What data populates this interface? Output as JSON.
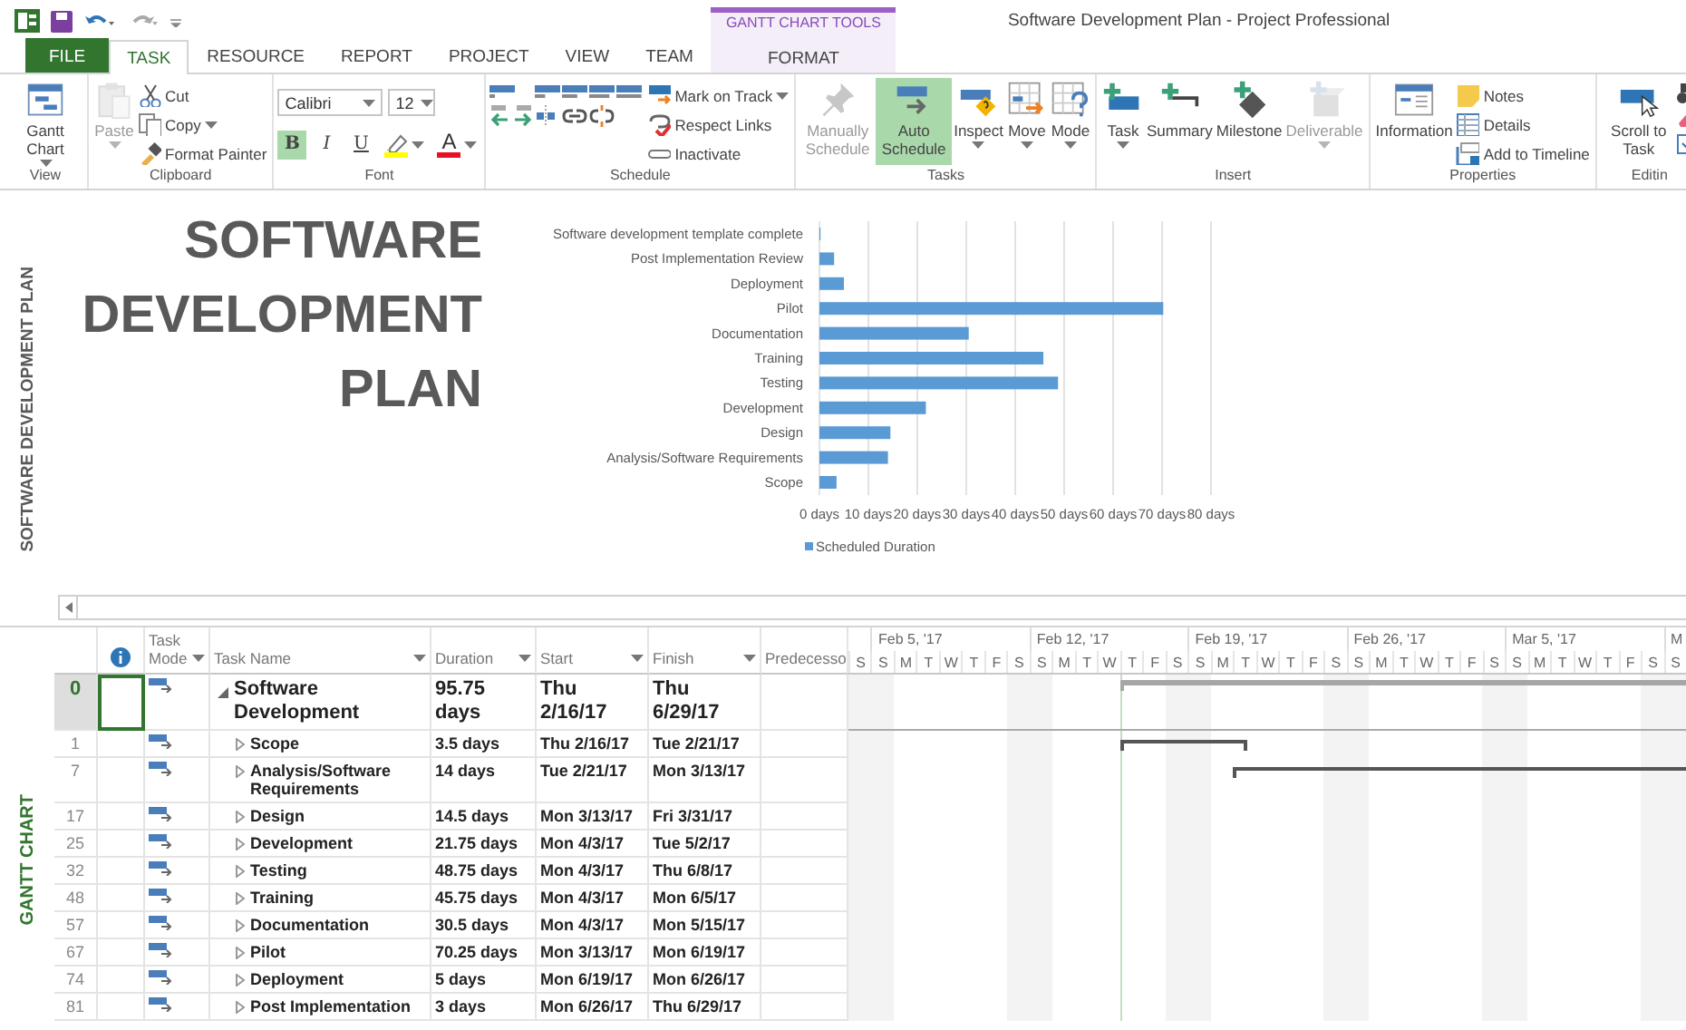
{
  "title_bar": {
    "title": "Software Development Plan - Project Professional",
    "context_label": "GANTT CHART TOOLS"
  },
  "tabs": [
    {
      "label": "FILE",
      "kind": "file",
      "selected": false
    },
    {
      "label": "TASK",
      "kind": "normal",
      "selected": true
    },
    {
      "label": "RESOURCE",
      "kind": "normal",
      "selected": false
    },
    {
      "label": "REPORT",
      "kind": "normal",
      "selected": false
    },
    {
      "label": "PROJECT",
      "kind": "normal",
      "selected": false
    },
    {
      "label": "VIEW",
      "kind": "normal",
      "selected": false
    },
    {
      "label": "TEAM",
      "kind": "normal",
      "selected": false
    },
    {
      "label": "FORMAT",
      "kind": "context",
      "selected": false
    }
  ],
  "ribbon": {
    "groups": [
      {
        "label": "View",
        "kind": "default",
        "items": [
          {
            "label": "Gantt Chart",
            "kind": "large",
            "dropdown": true,
            "disabled": false
          }
        ]
      },
      {
        "label": "Clipboard",
        "kind": "default",
        "items": [
          {
            "label": "Paste",
            "kind": "large",
            "dropdown": true,
            "disabled": true
          },
          {
            "label": "Cut",
            "kind": "small",
            "dropdown": false,
            "disabled": false
          },
          {
            "label": "Copy",
            "kind": "small",
            "dropdown": true,
            "disabled": false
          },
          {
            "label": "Format Painter",
            "kind": "small",
            "dropdown": false,
            "disabled": false
          }
        ]
      },
      {
        "label": "Font",
        "kind": "font",
        "items": [
          {
            "kind": "combo",
            "value": "Calibri"
          },
          {
            "kind": "combo",
            "value": "12"
          },
          {
            "kind": "toggle",
            "label": "B",
            "selected": true
          },
          {
            "kind": "toggle",
            "label": "I",
            "selected": false
          },
          {
            "kind": "toggle",
            "label": "U",
            "selected": false
          },
          {
            "kind": "color",
            "color": "#ffff00"
          },
          {
            "kind": "color",
            "label": "A",
            "color": "#e81123"
          }
        ]
      },
      {
        "label": "Schedule",
        "kind": "schedule",
        "items": [
          {
            "label": "Mark on Track",
            "kind": "small",
            "dropdown": true,
            "disabled": false
          },
          {
            "label": "Respect Links",
            "kind": "small",
            "dropdown": false,
            "disabled": false
          },
          {
            "label": "Inactivate",
            "kind": "small",
            "dropdown": false,
            "disabled": false
          }
        ]
      },
      {
        "label": "Tasks",
        "kind": "default",
        "items": [
          {
            "label": "Manually Schedule",
            "kind": "large",
            "dropdown": false,
            "disabled": true,
            "selected": false
          },
          {
            "label": "Auto Schedule",
            "kind": "large",
            "dropdown": false,
            "disabled": false,
            "selected": true
          },
          {
            "label": "Inspect",
            "kind": "large",
            "dropdown": true,
            "disabled": false
          },
          {
            "label": "Move",
            "kind": "large",
            "dropdown": true,
            "disabled": false
          },
          {
            "label": "Mode",
            "kind": "large",
            "dropdown": true,
            "disabled": false
          }
        ]
      },
      {
        "label": "Insert",
        "kind": "default",
        "items": [
          {
            "label": "Task",
            "kind": "large",
            "dropdown": true,
            "disabled": false
          },
          {
            "label": "Summary",
            "kind": "large",
            "dropdown": false,
            "disabled": false
          },
          {
            "label": "Milestone",
            "kind": "large",
            "dropdown": false,
            "disabled": false
          },
          {
            "label": "Deliverable",
            "kind": "large",
            "dropdown": true,
            "disabled": true
          }
        ]
      },
      {
        "label": "Properties",
        "kind": "default",
        "items": [
          {
            "label": "Information",
            "kind": "large",
            "dropdown": false,
            "disabled": false
          },
          {
            "label": "Notes",
            "kind": "small",
            "dropdown": false,
            "disabled": false
          },
          {
            "label": "Details",
            "kind": "small",
            "dropdown": false,
            "disabled": false
          },
          {
            "label": "Add to Timeline",
            "kind": "small",
            "dropdown": false,
            "disabled": false
          }
        ]
      },
      {
        "label": "Editin",
        "kind": "editing",
        "items": [
          {
            "label": "Scroll to Task",
            "kind": "large",
            "dropdown": false,
            "disabled": false
          }
        ]
      }
    ]
  },
  "report": {
    "side_label": "SOFTWARE DEVELOPMENT PLAN",
    "title": "SOFTWARE DEVELOPMENT PLAN",
    "chart_data": {
      "type": "bar",
      "orientation": "horizontal",
      "grid": true,
      "categories": [
        "Software development template complete",
        "Post Implementation Review",
        "Deployment",
        "Pilot",
        "Documentation",
        "Training",
        "Testing",
        "Development",
        "Design",
        "Analysis/Software Requirements",
        "Scope"
      ],
      "series": [
        {
          "name": "Scheduled Duration",
          "color": "#5b9bd5",
          "values": [
            0,
            3,
            5,
            70.25,
            30.5,
            45.75,
            48.75,
            21.75,
            14.5,
            14,
            3.5
          ]
        }
      ],
      "xlim": [
        0,
        80
      ],
      "xticks": [
        {
          "value": 0,
          "label": "0 days"
        },
        {
          "value": 10,
          "label": "10 days"
        },
        {
          "value": 20,
          "label": "20 days"
        },
        {
          "value": 30,
          "label": "30 days"
        },
        {
          "value": 40,
          "label": "40 days"
        },
        {
          "value": 50,
          "label": "50 days"
        },
        {
          "value": 60,
          "label": "60 days"
        },
        {
          "value": 70,
          "label": "70 days"
        },
        {
          "value": 80,
          "label": "80 days"
        }
      ]
    }
  },
  "gantt": {
    "side_label": "GANTT CHART",
    "columns": [
      {
        "label": "Task Mode",
        "dropdown": true
      },
      {
        "label": "Task Name",
        "dropdown": true
      },
      {
        "label": "Duration",
        "dropdown": true
      },
      {
        "label": "Start",
        "dropdown": true
      },
      {
        "label": "Finish",
        "dropdown": true
      },
      {
        "label": "Predecesso",
        "dropdown": false
      }
    ],
    "rows": [
      {
        "id": "0",
        "name": "Software Development",
        "duration": "95.75 days",
        "start": "Thu 2/16/17",
        "finish": "Thu 6/29/17",
        "expanded": true,
        "selected": true
      },
      {
        "id": "1",
        "name": "Scope",
        "duration": "3.5 days",
        "start": "Thu 2/16/17",
        "finish": "Tue 2/21/17",
        "expanded": false,
        "selected": false
      },
      {
        "id": "7",
        "name": "Analysis/Software Requirements",
        "duration": "14 days",
        "start": "Tue 2/21/17",
        "finish": "Mon 3/13/17",
        "expanded": false,
        "selected": false
      },
      {
        "id": "17",
        "name": "Design",
        "duration": "14.5 days",
        "start": "Mon 3/13/17",
        "finish": "Fri 3/31/17",
        "expanded": false,
        "selected": false
      },
      {
        "id": "25",
        "name": "Development",
        "duration": "21.75 days",
        "start": "Mon 4/3/17",
        "finish": "Tue 5/2/17",
        "expanded": false,
        "selected": false
      },
      {
        "id": "32",
        "name": "Testing",
        "duration": "48.75 days",
        "start": "Mon 4/3/17",
        "finish": "Thu 6/8/17",
        "expanded": false,
        "selected": false
      },
      {
        "id": "48",
        "name": "Training",
        "duration": "45.75 days",
        "start": "Mon 4/3/17",
        "finish": "Mon 6/5/17",
        "expanded": false,
        "selected": false
      },
      {
        "id": "57",
        "name": "Documentation",
        "duration": "30.5 days",
        "start": "Mon 4/3/17",
        "finish": "Mon 5/15/17",
        "expanded": false,
        "selected": false
      },
      {
        "id": "67",
        "name": "Pilot",
        "duration": "70.25 days",
        "start": "Mon 3/13/17",
        "finish": "Mon 6/19/17",
        "expanded": false,
        "selected": false
      },
      {
        "id": "74",
        "name": "Deployment",
        "duration": "5 days",
        "start": "Mon 6/19/17",
        "finish": "Mon 6/26/17",
        "expanded": false,
        "selected": false
      },
      {
        "id": "81",
        "name": "Post Implementation",
        "duration": "3 days",
        "start": "Mon 6/26/17",
        "finish": "Thu 6/29/17",
        "expanded": false,
        "selected": false
      }
    ],
    "timeline": {
      "weeks": [
        "Feb 5, '17",
        "Feb 12, '17",
        "Feb 19, '17",
        "Feb 26, '17",
        "Mar 5, '17",
        "M"
      ],
      "days": [
        "S",
        "S",
        "M",
        "T",
        "W",
        "T",
        "F",
        "S",
        "S",
        "M",
        "T",
        "W",
        "T",
        "F",
        "S",
        "S",
        "M",
        "T",
        "W",
        "T",
        "F",
        "S",
        "S",
        "M",
        "T",
        "W",
        "T",
        "F",
        "S",
        "S",
        "M",
        "T",
        "W",
        "T",
        "F",
        "S",
        "S"
      ]
    }
  }
}
